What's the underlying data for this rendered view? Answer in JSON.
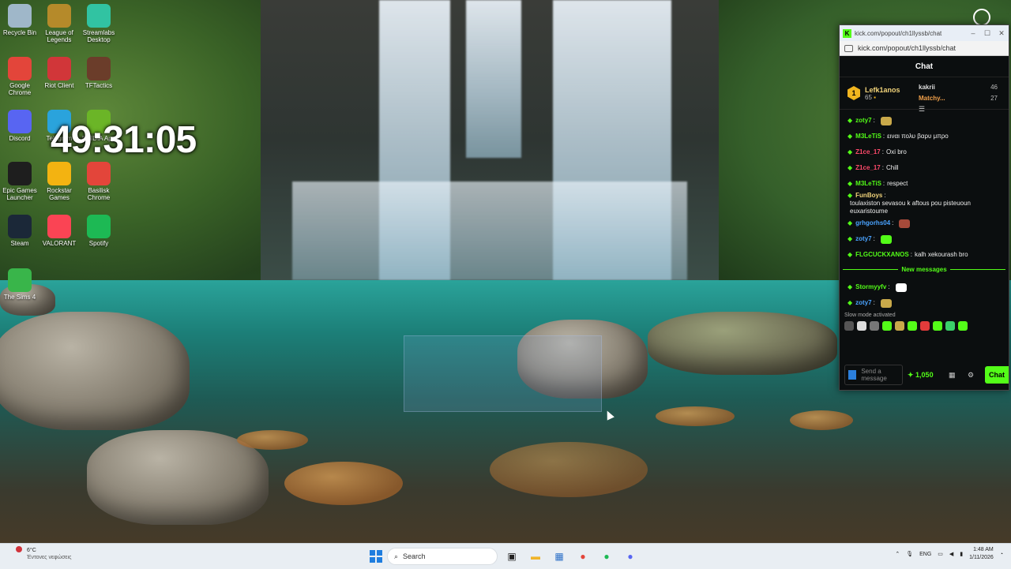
{
  "desktop": {
    "icons": [
      {
        "label": "Recycle Bin",
        "icon": "recycle-bin-icon",
        "color": "#9fb7c9"
      },
      {
        "label": "League of Legends",
        "icon": "league-icon",
        "color": "#b58a2a"
      },
      {
        "label": "Streamlabs Desktop",
        "icon": "streamlabs-icon",
        "color": "#31c3a2"
      },
      {
        "label": "Google Chrome",
        "icon": "chrome-icon",
        "color": "#e3453a"
      },
      {
        "label": "Riot Client",
        "icon": "riot-icon",
        "color": "#d13639"
      },
      {
        "label": "TFTactics",
        "icon": "tftactics-icon",
        "color": "#6b3d2a"
      },
      {
        "label": "Discord",
        "icon": "discord-icon",
        "color": "#5865f2"
      },
      {
        "label": "Telegram",
        "icon": "telegram-icon",
        "color": "#2aa3dc"
      },
      {
        "label": "NVIDIA App",
        "icon": "nvidia-icon",
        "color": "#6bb527"
      },
      {
        "label": "Epic Games Launcher",
        "icon": "epic-games-icon",
        "color": "#1e1e1e"
      },
      {
        "label": "Rockstar Games",
        "icon": "rockstar-icon",
        "color": "#f3b311"
      },
      {
        "label": "Basilisk Chrome",
        "icon": "chrome-icon-2",
        "color": "#e3453a"
      },
      {
        "label": "Steam",
        "icon": "steam-icon",
        "color": "#1b2838"
      },
      {
        "label": "VALORANT",
        "icon": "valorant-icon",
        "color": "#fa4454"
      },
      {
        "label": "Spotify",
        "icon": "spotify-icon",
        "color": "#1db954"
      },
      {
        "label": "The Sims 4",
        "icon": "sims-icon",
        "color": "#39b54a"
      }
    ],
    "clock": "49:31:05"
  },
  "chat_window": {
    "title_url": "kick.com/popout/ch1llyssb/chat",
    "address": "kick.com/popout/ch1llyssb/chat",
    "header": "Chat",
    "leaderboard": {
      "top_rank": "1",
      "top_name": "Lefk1anos",
      "top_value": "65",
      "second_name": "kakrii",
      "second_value": "46",
      "third_name": "Matchy...",
      "third_value": "27"
    },
    "messages": [
      {
        "user": "zoty7",
        "text": "",
        "color": "#53fc18",
        "emote": "#c9a94a"
      },
      {
        "user": "M3LeTiS",
        "text": "ειναι πολυ βαρυ μπρο",
        "color": "#53fc18"
      },
      {
        "user": "Z1ce_17",
        "text": "Oxi bro",
        "color": "#ff4a6b"
      },
      {
        "user": "Z1ce_17",
        "text": "Chill",
        "color": "#ff4a6b"
      },
      {
        "user": "M3LeTiS",
        "text": "respect",
        "color": "#53fc18"
      },
      {
        "user": "FunBoys",
        "text": "toulaxiston sevasou k aftous pou pisteuoun euxaristoume",
        "color": "#f1d37a"
      },
      {
        "user": "grhgorhs04",
        "text": "",
        "color": "#4aa3ff",
        "emote": "#a54a3a"
      },
      {
        "user": "zoty7",
        "text": "",
        "color": "#4aa3ff",
        "emote": "#53fc18"
      },
      {
        "user": "FLGCUCKXANOS",
        "text": "kalh xekourash bro",
        "color": "#53fc18"
      }
    ],
    "new_messages_label": "New messages",
    "new_messages": [
      {
        "user": "Stormyyfv",
        "text": "",
        "color": "#53fc18",
        "emote": "#ffffff"
      },
      {
        "user": "zoty7",
        "text": "",
        "color": "#4aa3ff",
        "emote": "#c9a94a"
      }
    ],
    "slow_mode": "Slow mode activated",
    "input_placeholder": "Send a message",
    "points": "1,050",
    "send_label": "Chat"
  },
  "taskbar": {
    "weather_temp": "6°C",
    "weather_desc": "Έντονες νεφώσεις",
    "search_placeholder": "Search",
    "language": "ENG",
    "time": "1:48 AM",
    "date": "1/11/2026"
  }
}
